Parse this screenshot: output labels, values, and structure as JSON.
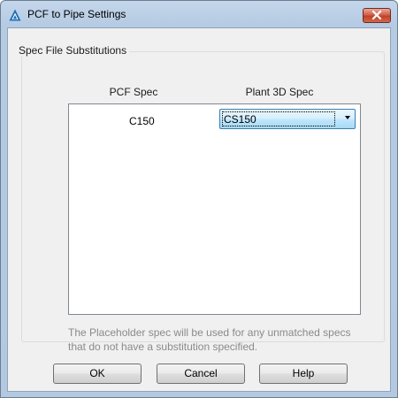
{
  "window": {
    "title": "PCF to Pipe Settings",
    "app_icon": "autodesk-a-icon",
    "close_icon": "close-x-icon"
  },
  "group": {
    "label": "Spec File Substitutions",
    "columns": {
      "pcf_spec": "PCF Spec",
      "plant3d_spec": "Plant 3D Spec"
    },
    "rows": [
      {
        "pcf_spec": "C150",
        "plant3d_spec": "CS150"
      }
    ],
    "note": "The Placeholder spec will be used for any unmatched specs that do not have a substitution specified."
  },
  "buttons": {
    "ok": "OK",
    "cancel": "Cancel",
    "help": "Help"
  },
  "colors": {
    "titlebar": "#b5cbe3",
    "close_button": "#c43f25",
    "dialog_background": "#f0f0f0",
    "combo_highlight": "#bee6fd",
    "note_text": "#8a8a8a"
  }
}
